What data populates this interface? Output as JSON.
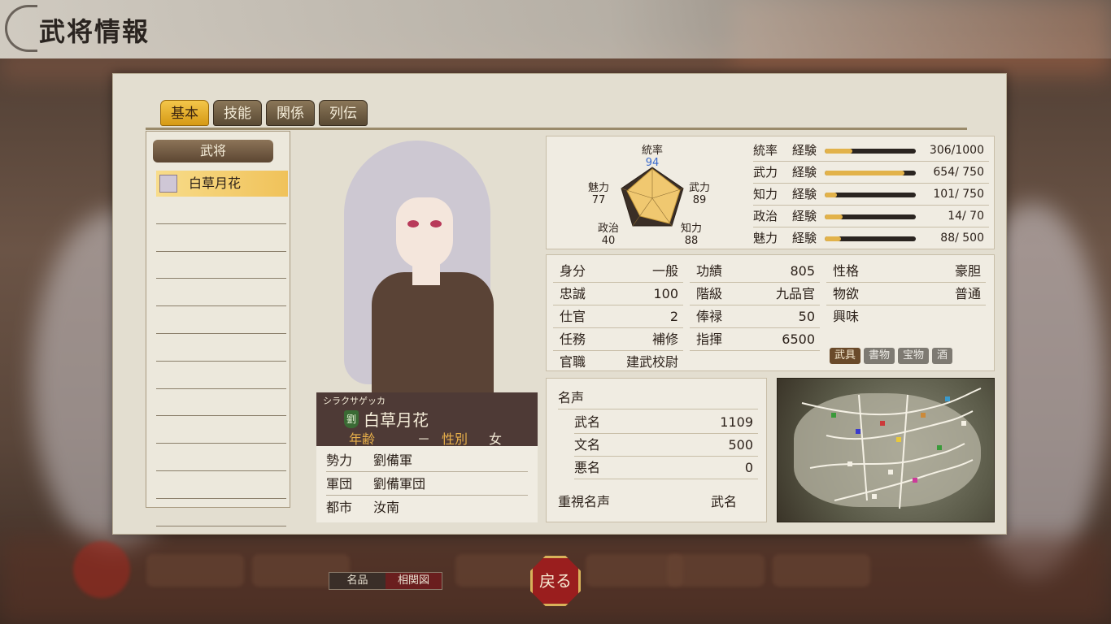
{
  "header": {
    "title": "武将情報"
  },
  "tabs": [
    {
      "label": "基本",
      "active": true
    },
    {
      "label": "技能",
      "active": false
    },
    {
      "label": "関係",
      "active": false
    },
    {
      "label": "列伝",
      "active": false
    }
  ],
  "list": {
    "header": "武将",
    "selected": "白草月花"
  },
  "officer": {
    "kana": "シラクサゲッカ",
    "faction_badge": "劉",
    "name": "白草月花",
    "age_label": "年齢",
    "age": "－",
    "sex_label": "性別",
    "sex": "女",
    "affiliation": [
      {
        "key": "勢力",
        "value": "劉備軍"
      },
      {
        "key": "軍団",
        "value": "劉備軍団"
      },
      {
        "key": "都市",
        "value": "汝南"
      }
    ]
  },
  "radar": {
    "leadership": {
      "label": "統率",
      "value": "94"
    },
    "war": {
      "label": "武力",
      "value": "89"
    },
    "intel": {
      "label": "知力",
      "value": "88"
    },
    "politics": {
      "label": "政治",
      "value": "40"
    },
    "charm": {
      "label": "魅力",
      "value": "77"
    }
  },
  "experience": [
    {
      "stat": "統率",
      "label": "経験",
      "current": 306,
      "max": 1000,
      "text": "306/1000"
    },
    {
      "stat": "武力",
      "label": "経験",
      "current": 654,
      "max": 750,
      "text": "654/ 750"
    },
    {
      "stat": "知力",
      "label": "経験",
      "current": 101,
      "max": 750,
      "text": "101/ 750"
    },
    {
      "stat": "政治",
      "label": "経験",
      "current": 14,
      "max": 70,
      "text": "14/  70"
    },
    {
      "stat": "魅力",
      "label": "経験",
      "current": 88,
      "max": 500,
      "text": "88/ 500"
    }
  ],
  "attributes": {
    "col1": [
      {
        "key": "身分",
        "value": "一般"
      },
      {
        "key": "忠誠",
        "value": "100"
      },
      {
        "key": "仕官",
        "value": "2"
      },
      {
        "key": "任務",
        "value": "補修"
      },
      {
        "key": "官職",
        "value": "建武校尉"
      }
    ],
    "col2": [
      {
        "key": "功績",
        "value": "805"
      },
      {
        "key": "階級",
        "value": "九品官"
      },
      {
        "key": "俸禄",
        "value": "50"
      },
      {
        "key": "指揮",
        "value": "6500"
      }
    ],
    "col3": [
      {
        "key": "性格",
        "value": "豪胆"
      },
      {
        "key": "物欲",
        "value": "普通"
      },
      {
        "key": "興味",
        "value": ""
      }
    ],
    "interests": [
      {
        "label": "武具",
        "active": true
      },
      {
        "label": "書物",
        "active": false
      },
      {
        "label": "宝物",
        "active": false
      },
      {
        "label": "酒",
        "active": false
      }
    ]
  },
  "fame": {
    "title": "名声",
    "rows": [
      {
        "key": "武名",
        "value": "1109"
      },
      {
        "key": "文名",
        "value": "500"
      },
      {
        "key": "悪名",
        "value": "0"
      }
    ],
    "priority_label": "重視名声",
    "priority_value": "武名"
  },
  "bottom": {
    "toggle": [
      "名品",
      "相関図"
    ],
    "toggle_active": 1,
    "back": "戻る"
  },
  "colors": {
    "accent_gold": "#e2b24a",
    "tab_active": "#f0b83a",
    "back_button": "#9a1e1e"
  }
}
